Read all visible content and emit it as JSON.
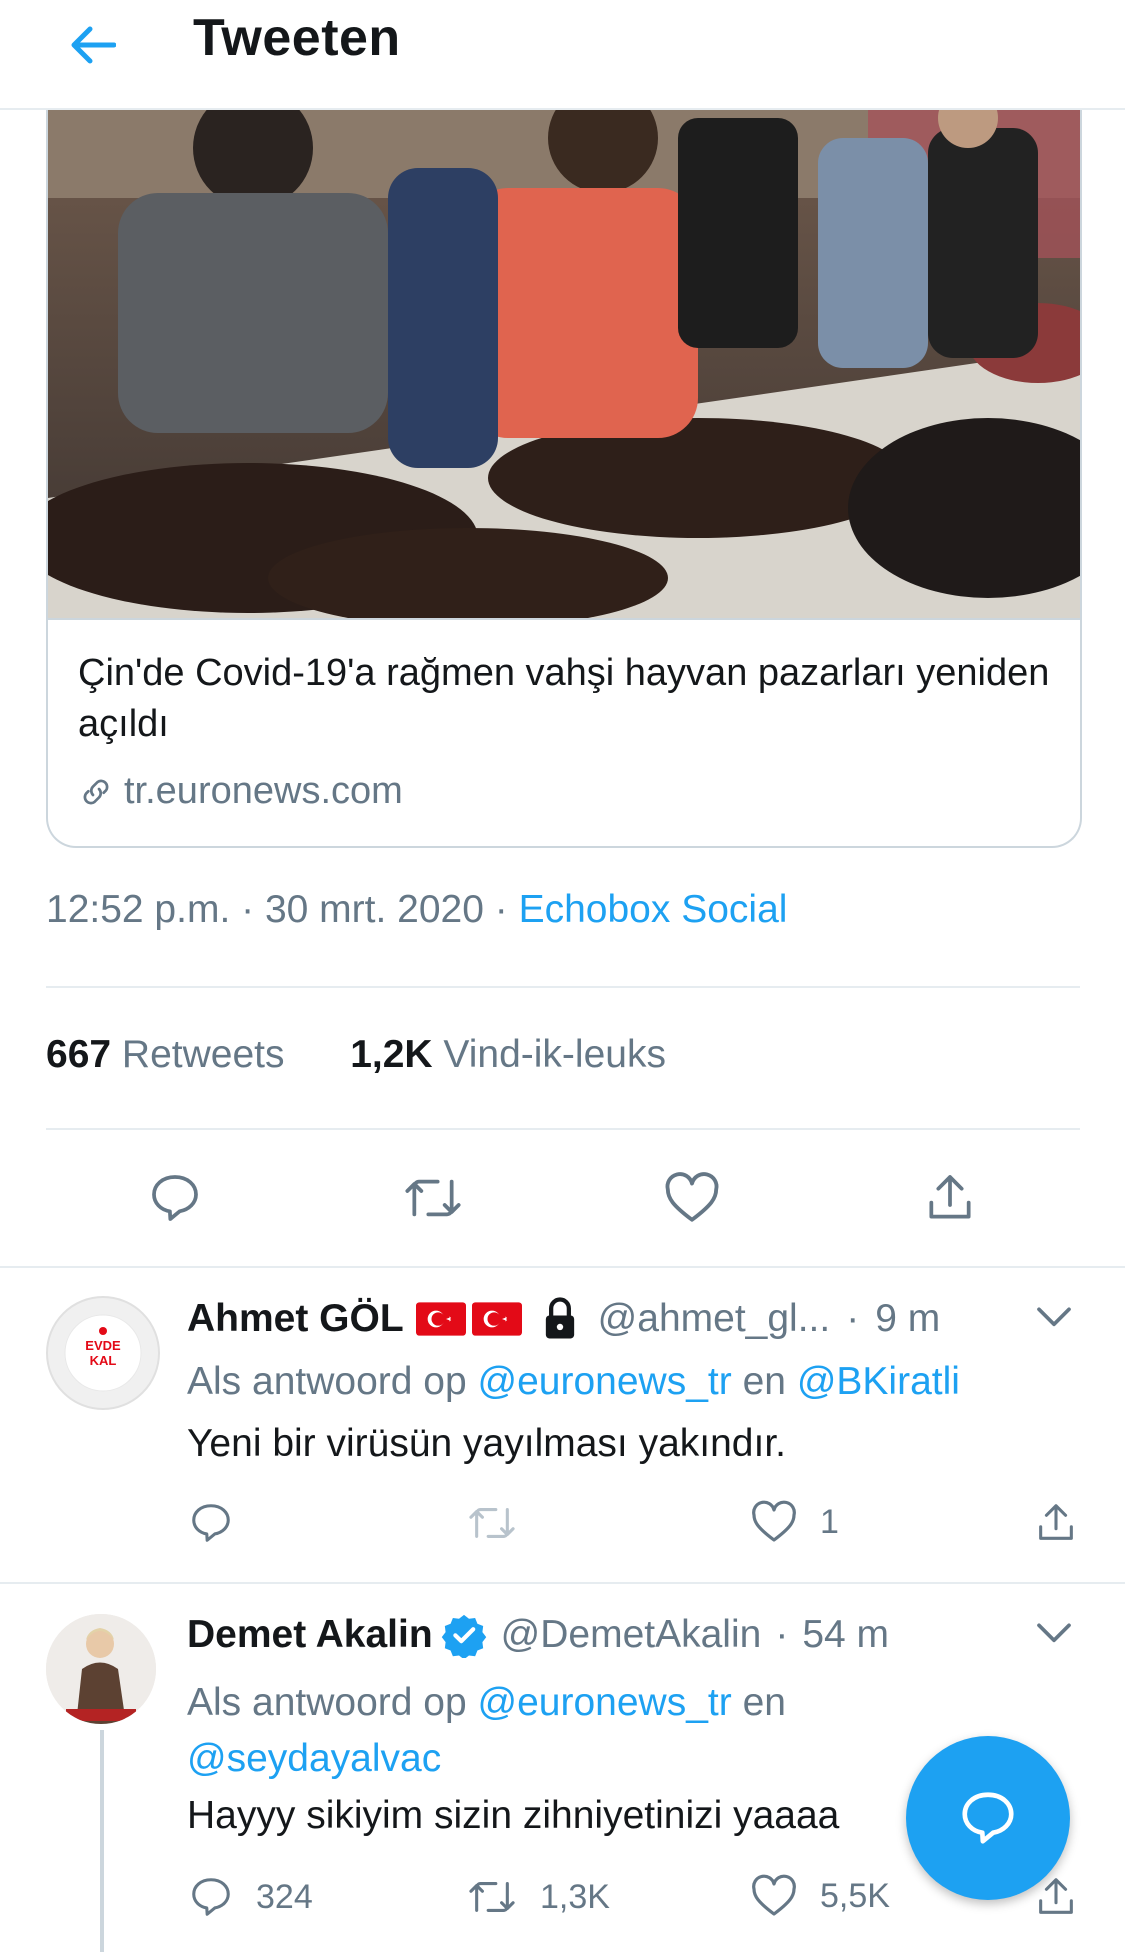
{
  "header": {
    "title": "Tweeten"
  },
  "card": {
    "title": "Çin'de Covid-19'a rağmen vahşi hayvan pazarları yeniden açıldı",
    "domain": "tr.euronews.com"
  },
  "tweet": {
    "time": "12:52 p.m.",
    "date": "30 mrt. 2020",
    "source": "Echobox Social",
    "retweets_count": "667",
    "retweets_label": "Retweets",
    "likes_count": "1,2K",
    "likes_label": "Vind-ik-leuks"
  },
  "replies": [
    {
      "name": "Ahmet GÖL",
      "handle": "@ahmet_gl...",
      "time": "9 m",
      "avatar_text": "EVDE KAL",
      "reply_prefix": "Als antwoord op",
      "reply_to_1": "@euronews_tr",
      "reply_sep": "en",
      "reply_to_2": "@BKiratli",
      "text": "Yeni bir virüsün yayılması yakındır.",
      "likes": "1"
    },
    {
      "name": "Demet Akalin",
      "handle": "@DemetAkalin",
      "time": "54 m",
      "reply_prefix": "Als antwoord op",
      "reply_to_1": "@euronews_tr",
      "reply_sep": "en",
      "reply_to_2": "@seydayalvac",
      "text": "Hayyy sikiyim sizin zihniyetinizi yaaaa",
      "replies": "324",
      "retweets": "1,3K",
      "likes": "5,5K"
    }
  ],
  "colors": {
    "accent": "#1da1f2",
    "muted": "#657786",
    "text": "#14171a",
    "border": "#e6ecf0"
  },
  "icons": [
    "back-arrow-icon",
    "link-icon",
    "reply-icon",
    "retweet-icon",
    "like-icon",
    "share-icon",
    "chevron-down-icon",
    "turkish-flag-icon",
    "lock-icon",
    "verified-icon",
    "compose-icon"
  ]
}
